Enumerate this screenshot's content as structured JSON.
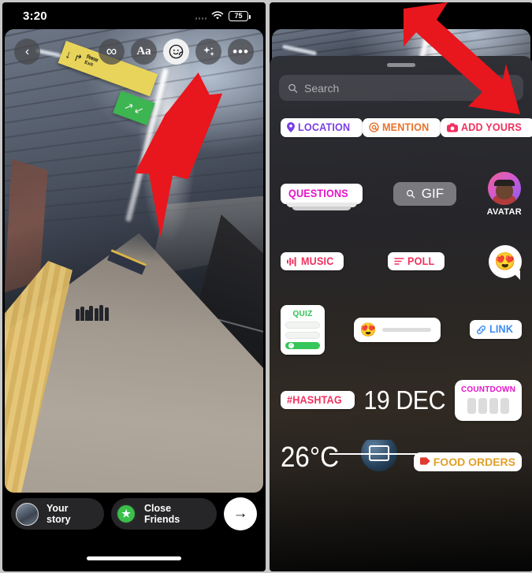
{
  "status_bar": {
    "time": "3:20",
    "signal_icon": "signal-dots-icon",
    "wifi_icon": "wifi-icon",
    "battery_level": "75"
  },
  "left_screen": {
    "top_toolbar": {
      "back_icon": "chevron-left-icon",
      "tools": [
        {
          "name": "loop-infinity-icon",
          "glyph": "∞",
          "active": false
        },
        {
          "name": "text-aa-icon",
          "glyph": "Aa",
          "active": false
        },
        {
          "name": "sticker-smiley-icon",
          "glyph": "☺",
          "active": true
        },
        {
          "name": "sparkles-effects-icon",
          "glyph": "✦",
          "active": false
        },
        {
          "name": "more-options-icon",
          "glyph": "•••",
          "active": false
        }
      ]
    },
    "photo": {
      "exit_sign_down_arrow": "↓",
      "exit_sign_runner": "↱",
      "exit_sign_text_line1": "निकास",
      "exit_sign_text_line2": "Exit",
      "exit_green_glyph1": "↗",
      "exit_green_glyph2": "↙"
    },
    "bottom_bar": {
      "your_story_label": "Your story",
      "your_story_avatar": "avatar-icon",
      "close_friends_label": "Close Friends",
      "close_friends_icon": "star-icon",
      "close_friends_star": "★",
      "send_label": "→",
      "send_icon": "arrow-right-icon"
    }
  },
  "right_screen": {
    "grabber": "sheet-grabber",
    "search": {
      "placeholder": "Search",
      "value": "",
      "icon": "search-icon"
    },
    "stickers": {
      "row1": [
        {
          "name": "location-sticker",
          "label": "LOCATION",
          "icon": "map-pin-icon",
          "color": "#7b3fe4"
        },
        {
          "name": "mention-sticker",
          "label": "MENTION",
          "icon": "at-sign-icon",
          "color": "#e8722a",
          "prefix": "@"
        },
        {
          "name": "add-yours-sticker",
          "label": "ADD YOURS",
          "icon": "camera-icon",
          "color": "#f0315f"
        }
      ],
      "row2": [
        {
          "name": "questions-sticker",
          "label": "QUESTIONS",
          "color": "#e612c8"
        },
        {
          "name": "gif-sticker",
          "label": "GIF",
          "icon": "search-icon"
        },
        {
          "name": "avatar-sticker",
          "label": "AVATAR"
        }
      ],
      "row3": [
        {
          "name": "music-sticker",
          "label": "MUSIC",
          "icon": "equalizer-icon",
          "color": "#f0315f"
        },
        {
          "name": "poll-sticker",
          "label": "POLL",
          "icon": "poll-lines-icon",
          "color": "#f0315f"
        },
        {
          "name": "emoji-reaction-sticker",
          "emoji": "😍"
        }
      ],
      "row4": [
        {
          "name": "quiz-sticker",
          "label": "QUIZ",
          "color": "#2ec04e"
        },
        {
          "name": "emoji-slider-sticker",
          "emoji": "😍"
        },
        {
          "name": "link-sticker",
          "label": "LINK",
          "icon": "link-chain-icon",
          "color": "#3b8bf0"
        }
      ],
      "row5": [
        {
          "name": "hashtag-sticker",
          "label": "#HASHTAG",
          "color": "#f0315f"
        },
        {
          "name": "date-sticker",
          "label": "19 DEC"
        },
        {
          "name": "countdown-sticker",
          "label": "COUNTDOWN",
          "color": "#e612c8"
        }
      ],
      "row6": [
        {
          "name": "temperature-sticker",
          "label": "26°C"
        },
        {
          "name": "photo-frame-sticker",
          "label": ""
        },
        {
          "name": "food-orders-sticker",
          "label": "FOOD ORDERS",
          "icon": "food-tag-icon",
          "color": "#e0a02a"
        }
      ]
    }
  },
  "annotations": {
    "arrow_left_target": "sticker-smiley-icon",
    "arrow_right_target": "link-sticker",
    "arrow_color": "#e8161d"
  }
}
